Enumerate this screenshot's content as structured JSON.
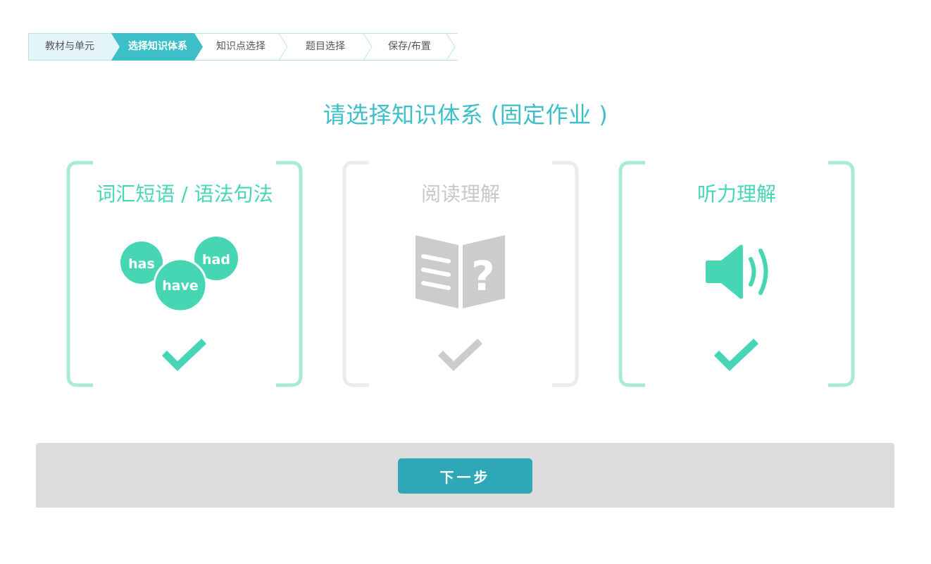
{
  "stepper": {
    "steps": [
      {
        "label": "教材与单元",
        "state": "done"
      },
      {
        "label": "选择知识体系",
        "state": "active"
      },
      {
        "label": "知识点选择",
        "state": "todo"
      },
      {
        "label": "题目选择",
        "state": "todo"
      },
      {
        "label": "保存/布置",
        "state": "todo"
      }
    ]
  },
  "page_title": "请选择知识体系 (固定作业 )",
  "cards": [
    {
      "title": "词汇短语 / 语法句法",
      "state": "selected",
      "icon": "word-bubbles-icon",
      "words": [
        "has",
        "had",
        "have"
      ]
    },
    {
      "title": "阅读理解",
      "state": "disabled",
      "icon": "book-question-icon",
      "glyph": "?"
    },
    {
      "title": "听力理解",
      "state": "selected",
      "icon": "speaker-icon"
    }
  ],
  "footer": {
    "next_label": "下一步"
  },
  "colors": {
    "accent_teal": "#3dbfc9",
    "stepper_active": "#3dbfc9",
    "stepper_done_bg": "#e3f5f9",
    "card_green": "#46d6b3",
    "bracket_green": "#a8ebd7",
    "disabled_gray": "#cccccc",
    "button": "#2ea7b7",
    "footer_bg": "#dcdcdc"
  }
}
